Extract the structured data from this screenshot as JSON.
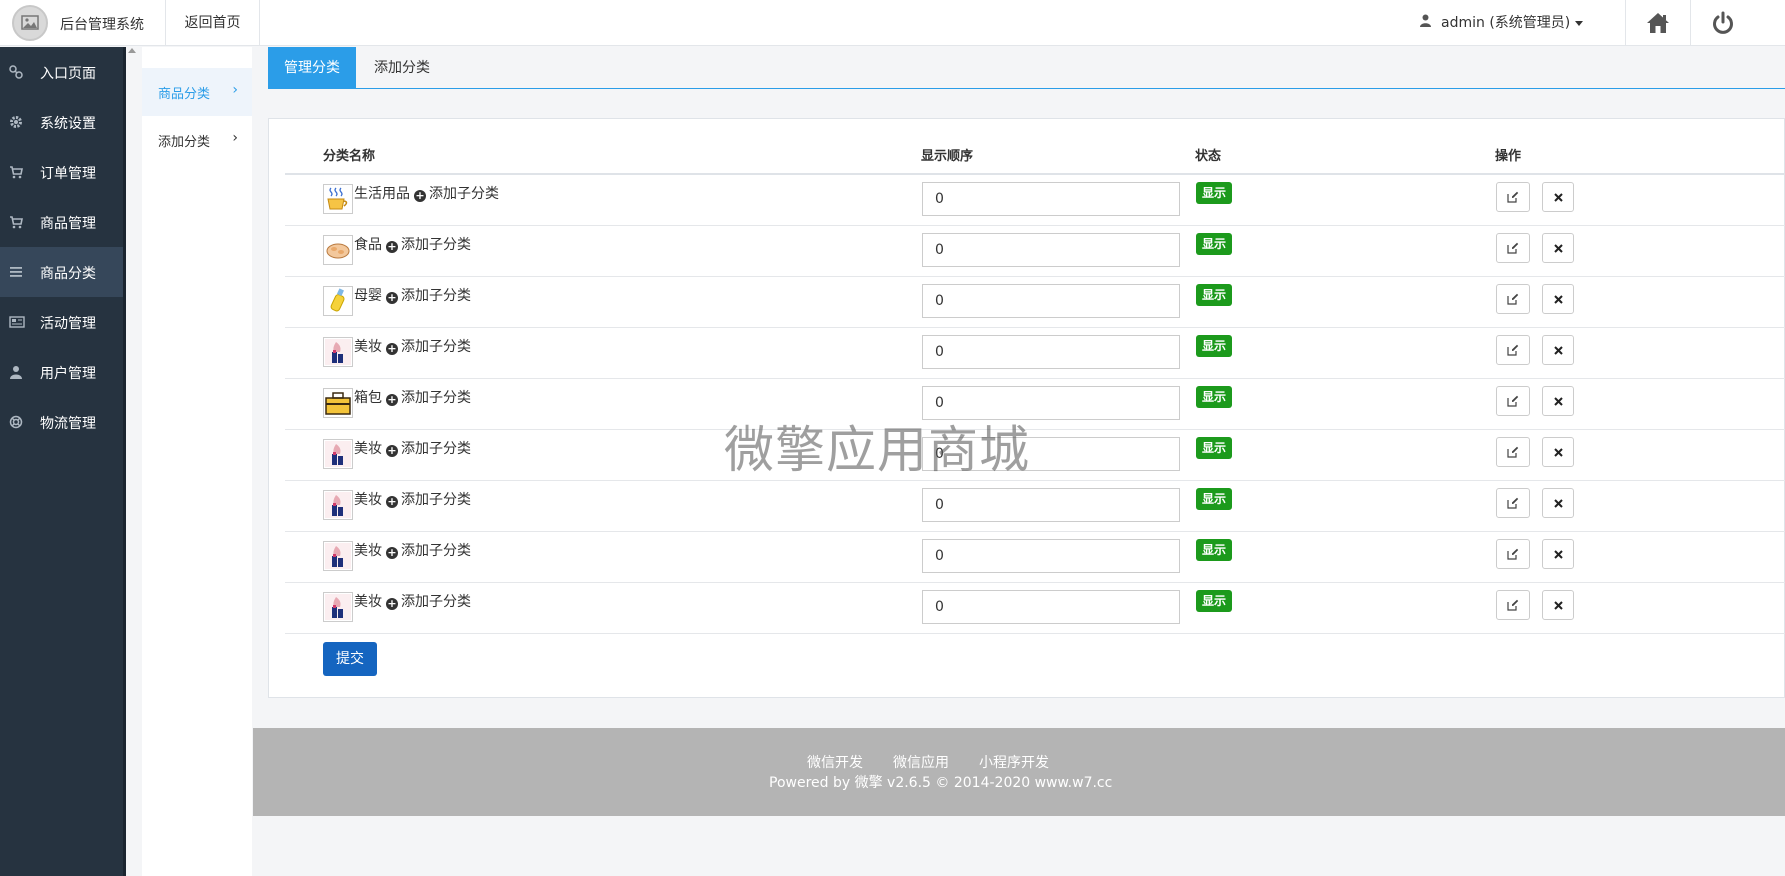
{
  "header": {
    "system_name": "后台管理系统",
    "back_home": "返回首页",
    "user": "admin (系统管理员)"
  },
  "sidebar": {
    "items": [
      {
        "label": "入口页面",
        "icon": "link-icon"
      },
      {
        "label": "系统设置",
        "icon": "gear-icon"
      },
      {
        "label": "订单管理",
        "icon": "cart-icon"
      },
      {
        "label": "商品管理",
        "icon": "cart-icon"
      },
      {
        "label": "商品分类",
        "icon": "list-icon",
        "active": true
      },
      {
        "label": "活动管理",
        "icon": "newspaper-icon"
      },
      {
        "label": "用户管理",
        "icon": "user-icon"
      },
      {
        "label": "物流管理",
        "icon": "lifebuoy-icon"
      }
    ]
  },
  "subnav": {
    "items": [
      {
        "label": "商品分类",
        "active": true
      },
      {
        "label": "添加分类"
      }
    ]
  },
  "tabs": [
    {
      "label": "管理分类",
      "active": true
    },
    {
      "label": "添加分类"
    }
  ],
  "table": {
    "headers": [
      "分类名称",
      "显示顺序",
      "状态",
      "操作"
    ],
    "add_sub_label": "添加子分类",
    "rows": [
      {
        "name": "生活用品",
        "order": "0",
        "status": "显示",
        "img": "cup"
      },
      {
        "name": "食品",
        "order": "0",
        "status": "显示",
        "img": "snack"
      },
      {
        "name": "母婴",
        "order": "0",
        "status": "显示",
        "img": "bottle"
      },
      {
        "name": "美妆",
        "order": "0",
        "status": "显示",
        "img": "cosmetics"
      },
      {
        "name": "箱包",
        "order": "0",
        "status": "显示",
        "img": "bag"
      },
      {
        "name": "美妆",
        "order": "0",
        "status": "显示",
        "img": "cosmetics"
      },
      {
        "name": "美妆",
        "order": "0",
        "status": "显示",
        "img": "cosmetics"
      },
      {
        "name": "美妆",
        "order": "0",
        "status": "显示",
        "img": "cosmetics"
      },
      {
        "name": "美妆",
        "order": "0",
        "status": "显示",
        "img": "cosmetics"
      }
    ],
    "submit_label": "提交"
  },
  "watermark": "微擎应用商城",
  "footer": {
    "links": [
      "微信开发",
      "微信应用",
      "小程序开发"
    ],
    "powered": "Powered by 微擎 v2.6.5 © 2014-2020 www.w7.cc"
  },
  "colors": {
    "sidebar_bg": "#263340",
    "sidebar_active": "#36475a",
    "accent": "#2b9de8",
    "status_green": "#1c9a1c",
    "submit_blue": "#1565c0",
    "footer_bg": "#b4b4b4"
  }
}
